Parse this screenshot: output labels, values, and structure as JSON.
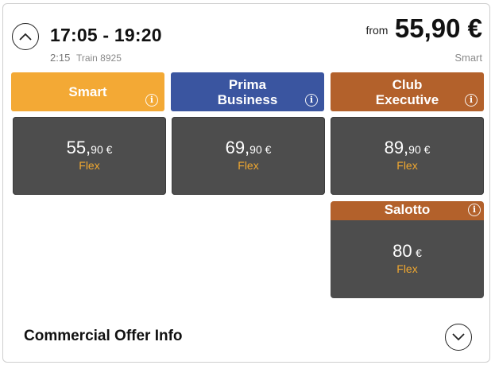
{
  "header": {
    "time_range": "17:05 - 19:20",
    "duration": "2:15",
    "train": "Train 8925",
    "from_label": "from",
    "from_price": "55,90 €",
    "from_class": "Smart"
  },
  "classes": [
    {
      "label_line1": "Smart",
      "label_line2": "",
      "info": "i",
      "color": "#f3a935"
    },
    {
      "label_line1": "Prima",
      "label_line2": "Business",
      "info": "i",
      "color": "#3a55a0"
    },
    {
      "label_line1": "Club",
      "label_line2": "Executive",
      "info": "i",
      "color": "#b3612b"
    }
  ],
  "fares": [
    {
      "amount": "55,",
      "cents": "90 €",
      "type": "Flex"
    },
    {
      "amount": "69,",
      "cents": "90 €",
      "type": "Flex"
    },
    {
      "amount": "89,",
      "cents": "90 €",
      "type": "Flex"
    }
  ],
  "salotto": {
    "label": "Salotto",
    "info": "i",
    "amount": "80",
    "currency": "€",
    "type": "Flex",
    "color": "#b3612b"
  },
  "footer": {
    "offer_info": "Commercial Offer Info"
  },
  "icons": {
    "collapse": "chevron-up-icon",
    "expand": "chevron-down-icon",
    "info": "info-icon"
  },
  "colors": {
    "tile_bg": "#4d4d4d",
    "flex_text": "#f0a830"
  }
}
